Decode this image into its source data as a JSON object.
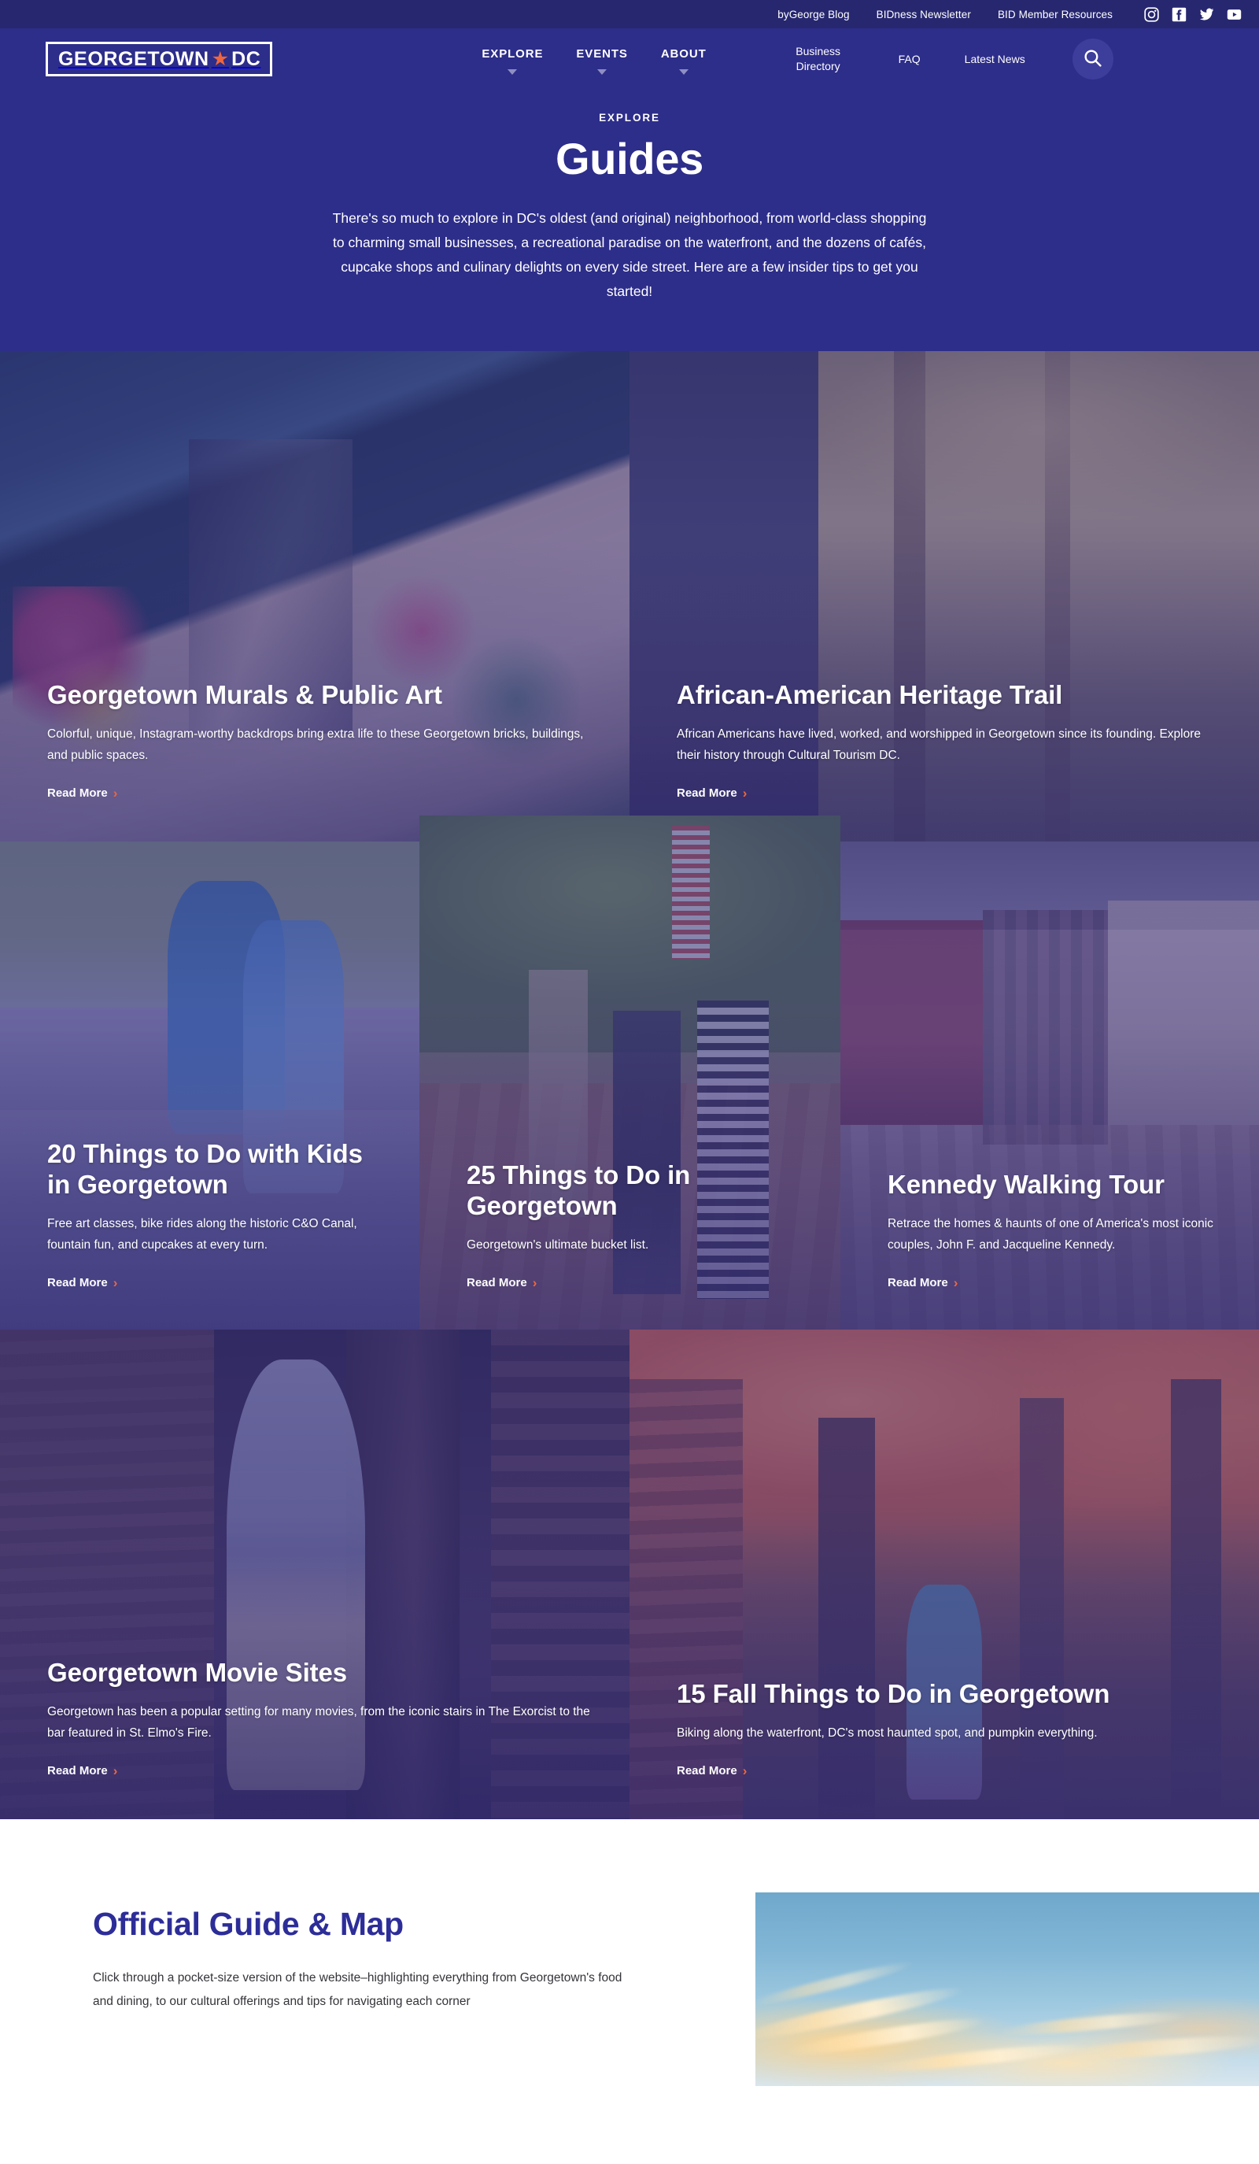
{
  "utility_bar": {
    "links": [
      {
        "label": "byGeorge Blog"
      },
      {
        "label": "BIDness Newsletter"
      },
      {
        "label": "BID Member Resources"
      }
    ],
    "social": [
      {
        "name": "instagram-icon"
      },
      {
        "name": "facebook-icon"
      },
      {
        "name": "twitter-icon"
      },
      {
        "name": "youtube-icon"
      }
    ]
  },
  "nav": {
    "logo": {
      "text_left": "GEORGETOWN",
      "star": "★",
      "text_right": "DC"
    },
    "primary": [
      {
        "label": "EXPLORE",
        "has_dropdown": true
      },
      {
        "label": "EVENTS",
        "has_dropdown": true
      },
      {
        "label": "ABOUT",
        "has_dropdown": true
      }
    ],
    "secondary": [
      {
        "label": "Business Directory"
      },
      {
        "label": "FAQ"
      },
      {
        "label": "Latest News"
      }
    ],
    "search_icon": "search-icon"
  },
  "hero": {
    "eyebrow": "EXPLORE",
    "title": "Guides",
    "description": "There's so much to explore in DC's oldest (and original) neighborhood, from world-class shopping to charming small businesses, a recreational paradise on the waterfront, and the dozens of cafés, cupcake shops and culinary delights on every side street. Here are a few insider tips to get you started!"
  },
  "cards": [
    {
      "title": "Georgetown Murals & Public Art",
      "description": "Colorful, unique, Instagram-worthy backdrops bring extra life to these Georgetown bricks, buildings, and public spaces.",
      "cta": "Read More",
      "chevron": "›"
    },
    {
      "title": "African-American Heritage Trail",
      "description": "African Americans have lived, worked, and worshipped in Georgetown since its founding. Explore their history through Cultural Tourism DC.",
      "cta": "Read More",
      "chevron": "›"
    },
    {
      "title": "20 Things to Do with Kids in Georgetown",
      "description": "Free art classes, bike rides along the historic C&O Canal, fountain fun, and cupcakes at every turn.",
      "cta": "Read More",
      "chevron": "›"
    },
    {
      "title": "25 Things to Do in Georgetown",
      "description": "Georgetown's ultimate bucket list.",
      "cta": "Read More",
      "chevron": "›"
    },
    {
      "title": "Kennedy Walking Tour",
      "description": "Retrace the homes & haunts of one of America's most iconic couples, John F. and Jacqueline Kennedy.",
      "cta": "Read More",
      "chevron": "›"
    },
    {
      "title": "Georgetown Movie Sites",
      "description": "Georgetown has been a popular setting for many movies, from the iconic stairs in The Exorcist to the bar featured in St. Elmo's Fire.",
      "cta": "Read More",
      "chevron": "›"
    },
    {
      "title": "15 Fall Things to Do in Georgetown",
      "description": "Biking along the waterfront, DC's most haunted spot, and pumpkin everything.",
      "cta": "Read More",
      "chevron": "›"
    }
  ],
  "guide_section": {
    "title": "Official Guide & Map",
    "description": "Click through a pocket-size version of the website–highlighting everything from Georgetown's food and dining, to our cultural offerings and tips for navigating each corner"
  },
  "colors": {
    "brand_navy": "#2d2d8a",
    "utility_navy": "#272770",
    "accent_orange": "#f0663c",
    "heading_blue": "#2d2d99",
    "white": "#ffffff"
  }
}
